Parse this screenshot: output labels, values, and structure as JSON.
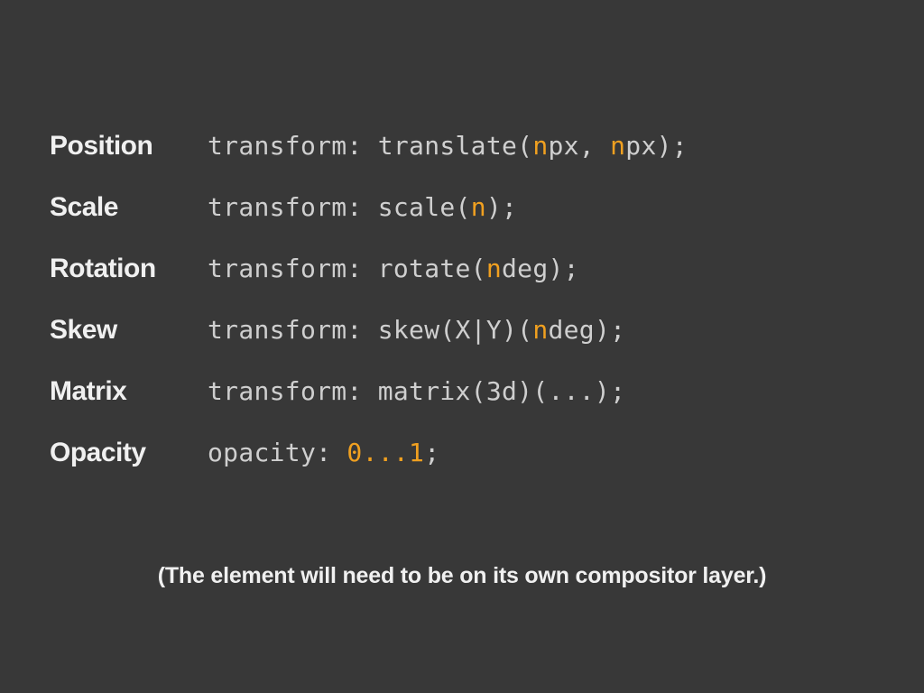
{
  "rows": [
    {
      "label": "Position",
      "segments": [
        {
          "text": "transform: translate(",
          "hl": false
        },
        {
          "text": "n",
          "hl": true
        },
        {
          "text": "px, ",
          "hl": false
        },
        {
          "text": "n",
          "hl": true
        },
        {
          "text": "px);",
          "hl": false
        }
      ]
    },
    {
      "label": "Scale",
      "segments": [
        {
          "text": "transform: scale(",
          "hl": false
        },
        {
          "text": "n",
          "hl": true
        },
        {
          "text": ");",
          "hl": false
        }
      ]
    },
    {
      "label": "Rotation",
      "segments": [
        {
          "text": "transform: rotate(",
          "hl": false
        },
        {
          "text": "n",
          "hl": true
        },
        {
          "text": "deg);",
          "hl": false
        }
      ]
    },
    {
      "label": "Skew",
      "segments": [
        {
          "text": "transform: skew(X|Y)(",
          "hl": false
        },
        {
          "text": "n",
          "hl": true
        },
        {
          "text": "deg);",
          "hl": false
        }
      ]
    },
    {
      "label": "Matrix",
      "segments": [
        {
          "text": "transform: matrix(3d)(...);",
          "hl": false
        }
      ]
    },
    {
      "label": "Opacity",
      "segments": [
        {
          "text": "opacity: ",
          "hl": false
        },
        {
          "text": "0...1",
          "hl": true
        },
        {
          "text": ";",
          "hl": false
        }
      ]
    }
  ],
  "footnote": "(The element will need to be on its own compositor layer.)"
}
